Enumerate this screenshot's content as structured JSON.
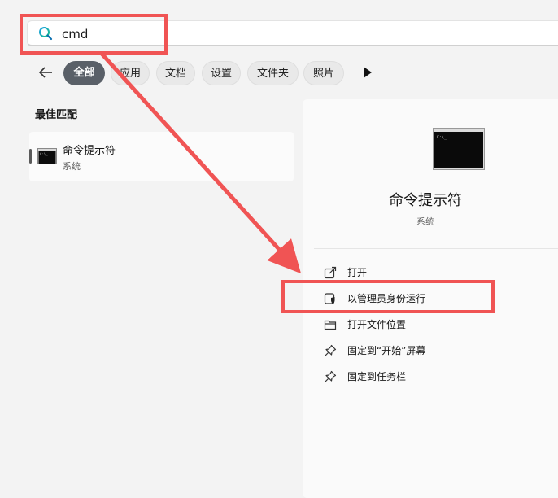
{
  "search": {
    "query": "cmd",
    "icon": "search-icon"
  },
  "filters": [
    "全部",
    "应用",
    "文档",
    "设置",
    "文件夹",
    "照片"
  ],
  "best_match": {
    "title": "最佳匹配",
    "item": {
      "name": "命令提示符",
      "type": "系统"
    }
  },
  "details": {
    "name": "命令提示符",
    "type": "系统",
    "actions": [
      {
        "label": "打开",
        "icon": "open-external-icon"
      },
      {
        "label": "以管理员身份运行",
        "icon": "shield-admin-icon"
      },
      {
        "label": "打开文件位置",
        "icon": "folder-icon"
      },
      {
        "label": "固定到“开始”屏幕",
        "icon": "pin-icon"
      },
      {
        "label": "固定到任务栏",
        "icon": "pin-icon"
      }
    ]
  },
  "colors": {
    "highlight": "#f05454",
    "accent_search": "#0a84c6",
    "active_filter": "#5a6068"
  }
}
